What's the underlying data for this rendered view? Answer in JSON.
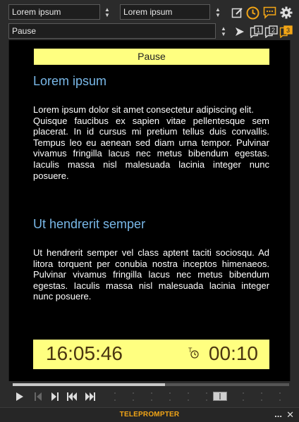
{
  "toolbar": {
    "source_select": "Lorem ipsum",
    "target_select": "Lorem ipsum",
    "mode_select": "Pause",
    "icons": [
      "edit-icon",
      "clock-icon",
      "message-icon",
      "gear-icon",
      "play-outline-icon",
      "page-1-icon",
      "page-2-icon",
      "page-3-icon"
    ],
    "accent_color": "#f2a516"
  },
  "prompter": {
    "banner": "Pause",
    "sections": [
      {
        "heading": "Lorem ipsum",
        "paragraph": "Lorem ipsum dolor sit amet consectetur adipiscing elit.\nQuisque faucibus ex sapien vitae pellentesque sem placerat. In id cursus mi pretium tellus duis convallis. Tempus leo eu aenean sed diam urna tempor. Pulvinar vivamus fringilla lacus nec metus bibendum egestas. Iaculis massa nisl malesuada lacinia integer nunc posuere."
      },
      {
        "heading": "Ut hendrerit semper",
        "paragraph": "Ut hendrerit semper vel class aptent taciti sociosqu. Ad litora torquent per conubia nostra inceptos himenaeos. Pulvinar vivamus fringilla lacus nec metus bibendum egestas. Iaculis massa nisl malesuada lacinia integer nunc posuere."
      }
    ],
    "clock": "16:05:46",
    "timer": "00:10",
    "heading_color": "#79b8e8",
    "highlight_color": "#ffff80"
  },
  "transport": {
    "progress": 0.55,
    "buttons": [
      "play-icon",
      "skip-start-icon",
      "step-forward-icon",
      "rewind-icon",
      "fast-forward-icon"
    ]
  },
  "footer": {
    "title": "TELEPROMPTER",
    "menu": "...",
    "close": "✕"
  }
}
